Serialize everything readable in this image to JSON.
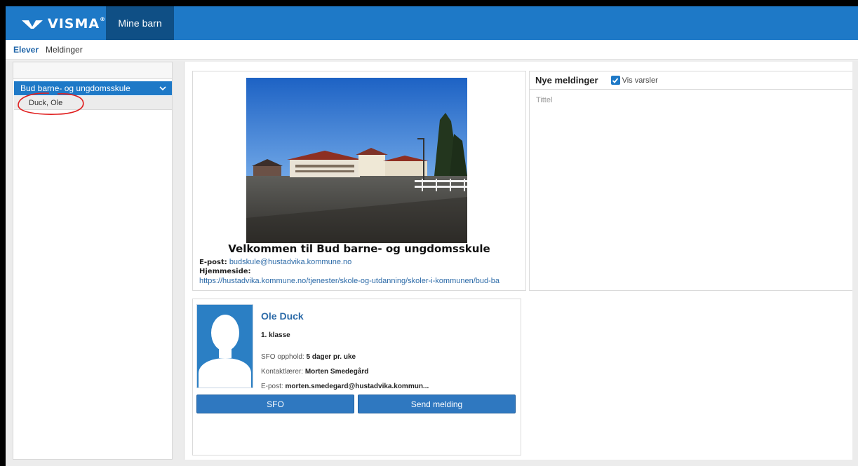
{
  "header": {
    "brand": "VISMA",
    "brand_mark": "®",
    "tab_label": "Mine barn"
  },
  "subnav": {
    "items": [
      "Elever",
      "Meldinger"
    ]
  },
  "sidebar": {
    "school_label": "Bud barne- og ungdomsskule",
    "child_label": "Duck, Ole"
  },
  "school": {
    "title": "Velkommen til Bud barne- og ungdomsskule",
    "email_label": "E-post:",
    "email": "budskule@hustadvika.kommune.no",
    "homepage_label": "Hjemmeside:",
    "homepage": "https://hustadvika.kommune.no/tjenester/skole-og-utdanning/skoler-i-kommunen/bud-ba"
  },
  "messages": {
    "title": "Nye meldinger",
    "checkbox_label": "Vis varsler",
    "column_title": "Tittel"
  },
  "student": {
    "name": "Ole Duck",
    "class": "1. klasse",
    "sfo_label": "SFO opphold:",
    "sfo_value": "5 dager pr. uke",
    "teacher_label": "Kontaktlærer:",
    "teacher_value": "Morten Smedegård",
    "email_label": "E-post:",
    "email_value": "morten.smedegard@hustadvika.kommun...",
    "btn_sfo": "SFO",
    "btn_send": "Send melding"
  },
  "colors": {
    "brand_blue": "#1e79c7",
    "tab_dark": "#0f4f85",
    "link": "#2d6ba8",
    "annotation_red": "#e02020"
  }
}
